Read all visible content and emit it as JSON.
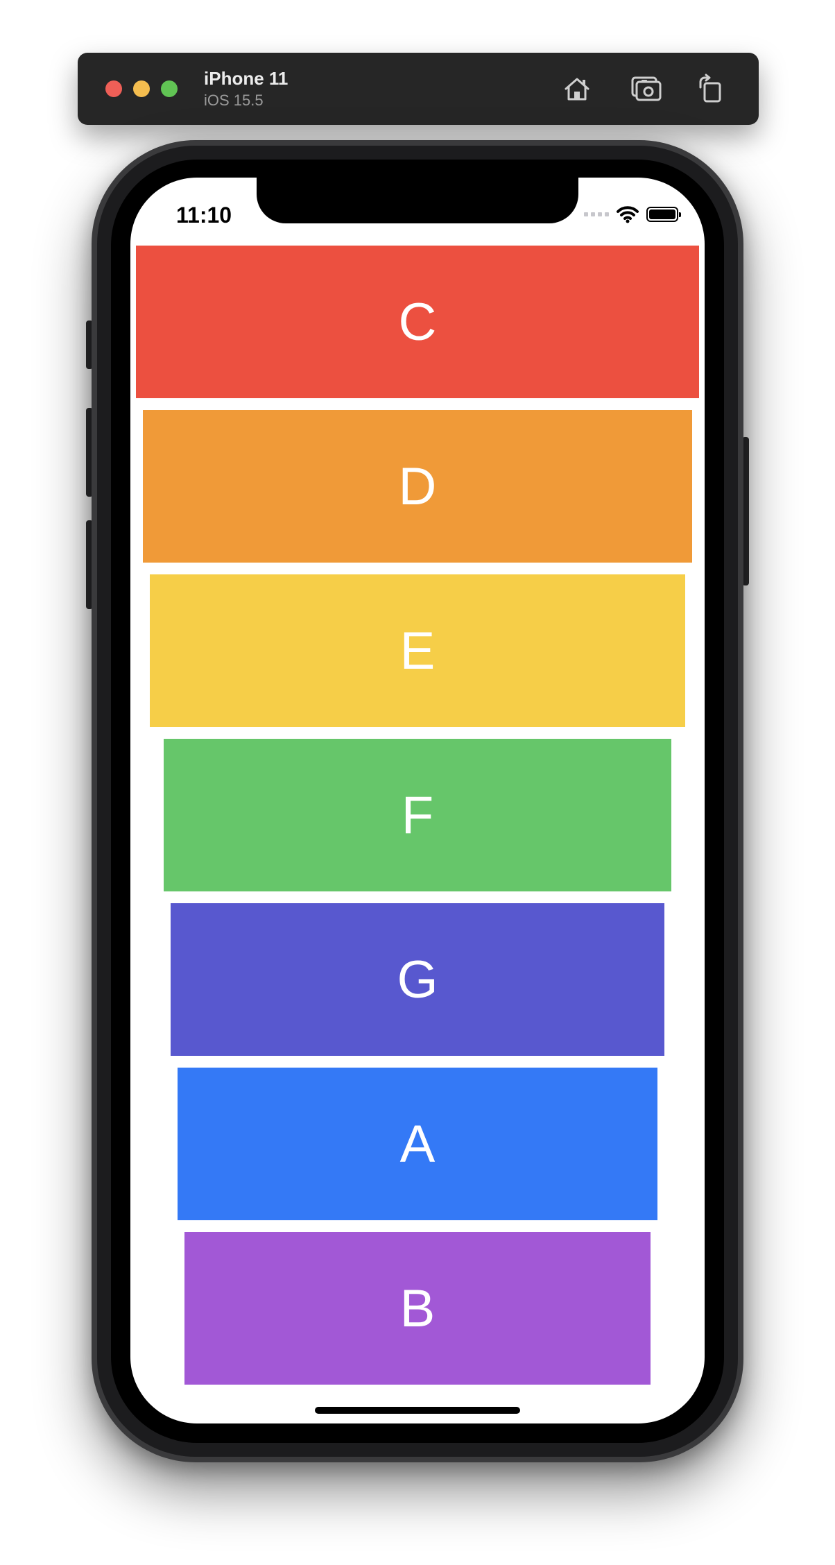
{
  "toolbar": {
    "device_name": "iPhone 11",
    "device_os": "iOS 15.5",
    "buttons": [
      {
        "icon": "home-icon"
      },
      {
        "icon": "screenshot-icon"
      },
      {
        "icon": "rotate-icon"
      }
    ],
    "traffic_lights": [
      "#ee5f57",
      "#f4bd4f",
      "#61c454"
    ]
  },
  "status_bar": {
    "time": "11:10"
  },
  "cards": [
    {
      "label": "C",
      "color": "#ec5040"
    },
    {
      "label": "D",
      "color": "#f09a38"
    },
    {
      "label": "E",
      "color": "#f6ce48"
    },
    {
      "label": "F",
      "color": "#66c66a"
    },
    {
      "label": "G",
      "color": "#5858cf"
    },
    {
      "label": "A",
      "color": "#3479f6"
    },
    {
      "label": "B",
      "color": "#a258d6"
    }
  ]
}
